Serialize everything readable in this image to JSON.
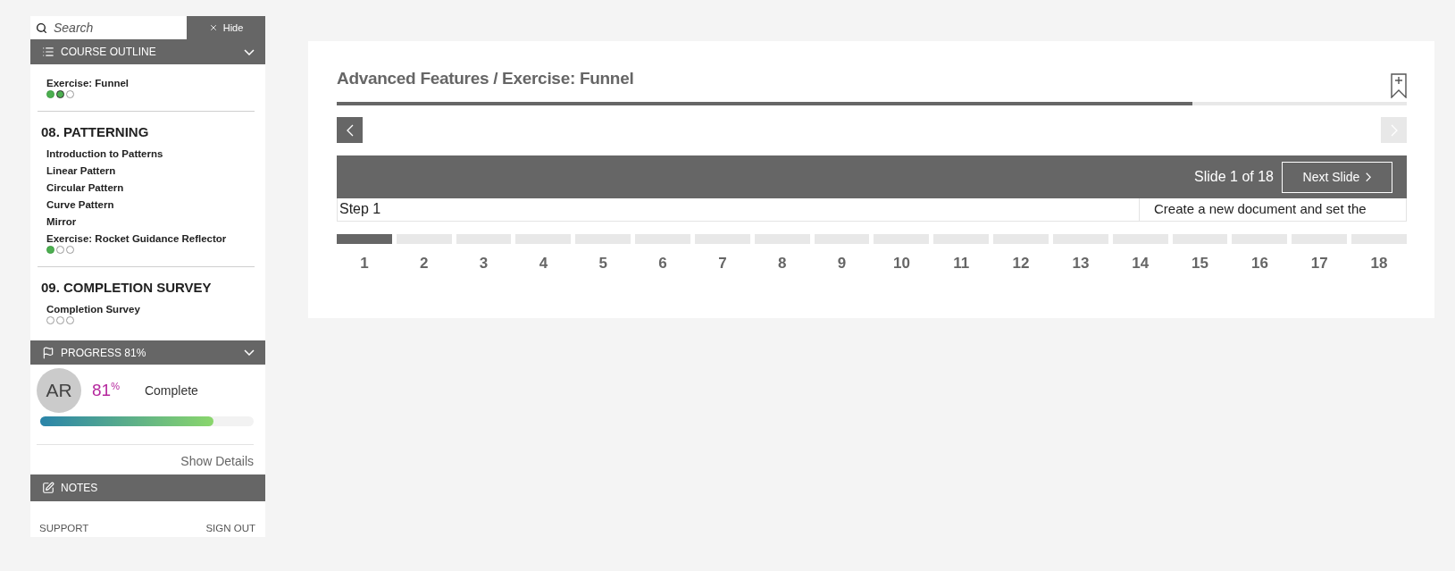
{
  "sidebar": {
    "search": {
      "placeholder": "Search"
    },
    "hide_button": {
      "label": "Hide"
    },
    "outline": {
      "title": "COURSE OUTLINE",
      "sections": [
        {
          "items": [
            {
              "label": "Exercise: Funnel",
              "dots": [
                {
                  "done": true,
                  "current": false
                },
                {
                  "done": true,
                  "current": true
                },
                {
                  "done": false,
                  "current": false
                }
              ]
            }
          ]
        },
        {
          "heading": "08. PATTERNING",
          "items": [
            {
              "label": "Introduction to Patterns"
            },
            {
              "label": "Linear Pattern"
            },
            {
              "label": "Circular Pattern"
            },
            {
              "label": "Curve Pattern"
            },
            {
              "label": "Mirror"
            },
            {
              "label": "Exercise: Rocket Guidance Reflector",
              "dots": [
                {
                  "done": true,
                  "current": false
                },
                {
                  "done": false,
                  "current": false
                },
                {
                  "done": false,
                  "current": false
                }
              ]
            }
          ]
        },
        {
          "heading": "09. COMPLETION SURVEY",
          "items": [
            {
              "label": "Completion Survey",
              "dots": [
                {
                  "done": false,
                  "current": false
                },
                {
                  "done": false,
                  "current": false
                },
                {
                  "done": false,
                  "current": false
                }
              ]
            }
          ]
        }
      ]
    },
    "progress": {
      "title": "PROGRESS 81%",
      "avatar": "AR",
      "percent": "81$^{%}$",
      "status": "Complete",
      "level": 0.81,
      "details_link": "Show Details"
    },
    "notes": {
      "title": "NOTES"
    },
    "footer_links": [
      "SUPPORT",
      "SIGN OUT"
    ]
  },
  "lesson": {
    "title": "Advanced Features / Exercise: Funnel",
    "progress": {
      "level": 0.8
    },
    "prev_button": {
      "disabled": false
    },
    "next_button": {
      "disabled": true
    },
    "slide_counter": "Slide 1 of 18",
    "next_slide_button": "Next Slide",
    "step": {
      "label": "Step 1",
      "instruction": "Create a new document and set the"
    },
    "slides": [
      {
        "label": "1",
        "selected": true
      },
      {
        "label": "2",
        "selected": false
      },
      {
        "label": "3",
        "selected": false
      },
      {
        "label": "4",
        "selected": false
      },
      {
        "label": "5",
        "selected": false
      },
      {
        "label": "6",
        "selected": false
      },
      {
        "label": "7",
        "selected": false
      },
      {
        "label": "8",
        "selected": false
      },
      {
        "label": "9",
        "selected": false
      },
      {
        "label": "10",
        "selected": false
      },
      {
        "label": "11",
        "selected": false
      },
      {
        "label": "12",
        "selected": false
      },
      {
        "label": "13",
        "selected": false
      },
      {
        "label": "14",
        "selected": false
      },
      {
        "label": "15",
        "selected": false
      },
      {
        "label": "16",
        "selected": false
      },
      {
        "label": "17",
        "selected": false
      },
      {
        "label": "18",
        "selected": false
      }
    ]
  }
}
